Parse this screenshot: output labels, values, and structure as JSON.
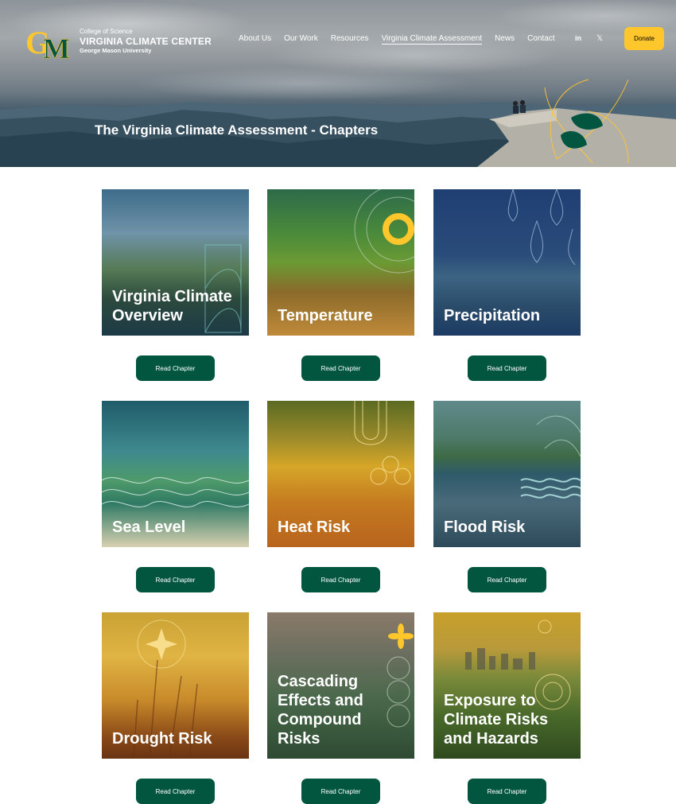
{
  "header": {
    "logo": {
      "college": "College of Science",
      "center": "VIRGINIA CLIMATE CENTER",
      "university": "George Mason University"
    },
    "nav": [
      {
        "label": "About Us",
        "active": false
      },
      {
        "label": "Our Work",
        "active": false
      },
      {
        "label": "Resources",
        "active": false
      },
      {
        "label": "Virginia Climate Assessment",
        "active": true
      },
      {
        "label": "News",
        "active": false
      },
      {
        "label": "Contact",
        "active": false
      }
    ],
    "social": {
      "linkedin": "in",
      "x": "𝕏"
    },
    "donate_label": "Donate"
  },
  "hero": {
    "title": "The Virginia Climate Assessment - Chapters"
  },
  "chapters": [
    {
      "title": "Virginia Climate Overview",
      "button": "Read Chapter"
    },
    {
      "title": "Temperature",
      "button": "Read Chapter"
    },
    {
      "title": "Precipitation",
      "button": "Read Chapter"
    },
    {
      "title": "Sea Level",
      "button": "Read Chapter"
    },
    {
      "title": "Heat Risk",
      "button": "Read Chapter"
    },
    {
      "title": "Flood Risk",
      "button": "Read Chapter"
    },
    {
      "title": "Drought Risk",
      "button": "Read Chapter"
    },
    {
      "title": "Cascading Effects and Compound Risks",
      "button": "Read Chapter"
    },
    {
      "title": "Exposure to Climate Risks and Hazards",
      "button": "Read Chapter"
    }
  ],
  "colors": {
    "brand_green": "#02563f",
    "accent_yellow": "#ffc72c"
  }
}
